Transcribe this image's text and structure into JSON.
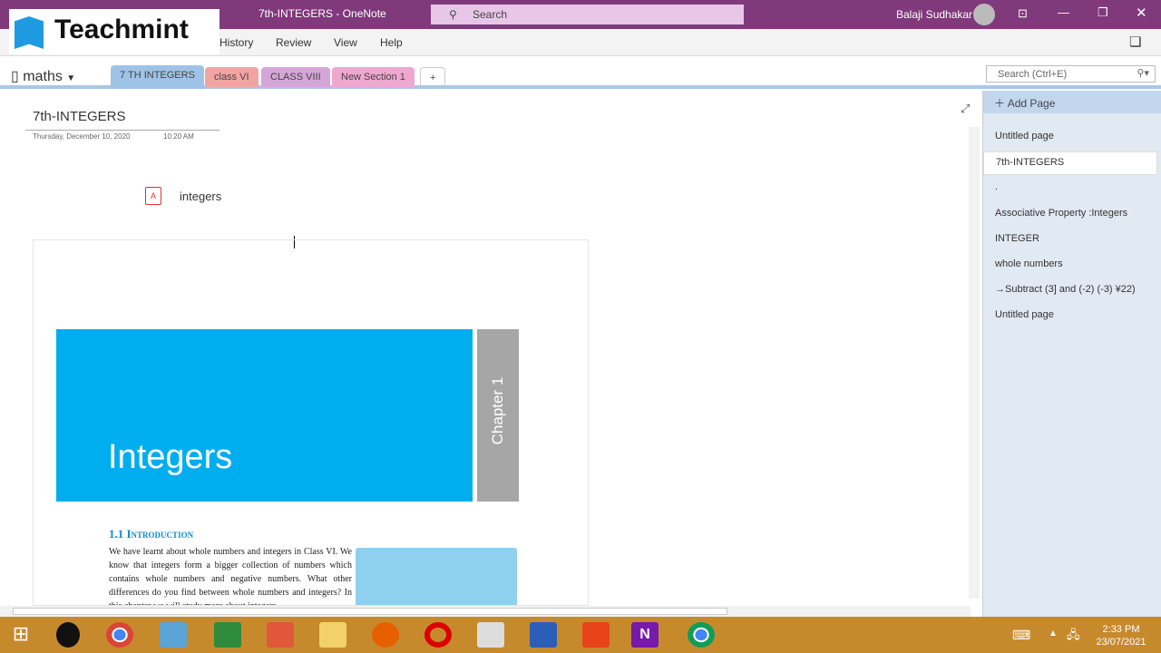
{
  "titlebar": {
    "title": "7th-INTEGERS  -  OneNote",
    "search": "Search",
    "user": "Balaji Sudhakar"
  },
  "watermark": {
    "logo_text": "Teachmint"
  },
  "ribbon": {
    "tabs": [
      "History",
      "Review",
      "View",
      "Help"
    ]
  },
  "notebook": {
    "name": "maths",
    "sections": [
      {
        "label": "7 TH INTEGERS",
        "color": "#9fc3e7"
      },
      {
        "label": "class VI",
        "color": "#f4a3a3"
      },
      {
        "label": "CLASS VIII",
        "color": "#d6a5d8"
      },
      {
        "label": "New Section 1",
        "color": "#f0a7cf"
      }
    ],
    "add_section": "+",
    "search_placeholder": "Search (Ctrl+E)"
  },
  "page": {
    "title": "7th-INTEGERS",
    "date": "Thursday, December 10, 2020",
    "time": "10:20 AM",
    "attachment": "integers",
    "pdf": {
      "banner_title": "Integers",
      "chapter": "Chapter 1",
      "section_heading": "1.1  Introduction",
      "body": "We have learnt about whole numbers and integers in Class VI. We know that integers form a bigger collection of numbers which contains whole numbers and negative numbers. What other differences do you find between whole numbers and integers? In this chapter we will study more about integers"
    }
  },
  "pages_panel": {
    "add_page": "Add Page",
    "items": [
      "Untitled page",
      "7th-INTEGERS",
      ".",
      "Associative Property :Integers",
      "INTEGER",
      "whole numbers",
      "→Subtract (3] and (-2) (-3) ¥22)",
      "Untitled page"
    ],
    "selected": 1
  },
  "taskbar": {
    "time": "2:33 PM",
    "date": "23/07/2021",
    "apps": [
      "start",
      "pen-app",
      "chrome",
      "media-player",
      "excel",
      "powerpoint",
      "file-explorer",
      "firefox",
      "opera",
      "snipping-tool",
      "word",
      "office",
      "onenote",
      "chrome-profile"
    ]
  }
}
